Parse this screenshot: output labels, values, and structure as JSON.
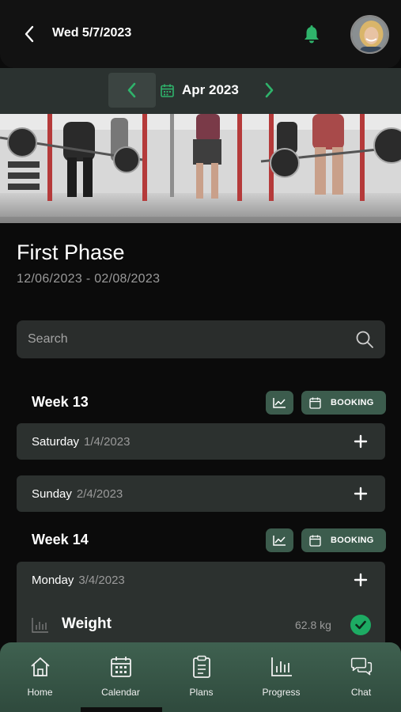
{
  "header": {
    "date": "Wed 5/7/2023"
  },
  "month_nav": {
    "label": "Apr 2023"
  },
  "phase": {
    "title": "First Phase",
    "dates": "12/06/2023 - 02/08/2023"
  },
  "search": {
    "placeholder": "Search"
  },
  "weeks": [
    {
      "title": "Week 13",
      "booking_label": "BOOKING",
      "days": [
        {
          "name": "Saturday",
          "date": "1/4/2023"
        },
        {
          "name": "Sunday",
          "date": "2/4/2023"
        }
      ]
    },
    {
      "title": "Week 14",
      "booking_label": "BOOKING",
      "days": [
        {
          "name": "Monday",
          "date": "3/4/2023",
          "entries": [
            {
              "name": "Weight",
              "value": "62.8 kg",
              "done": true
            }
          ]
        }
      ]
    }
  ],
  "nav": {
    "items": [
      {
        "label": "Home",
        "icon": "home-icon"
      },
      {
        "label": "Calendar",
        "icon": "calendar-icon",
        "active": true
      },
      {
        "label": "Plans",
        "icon": "clipboard-icon"
      },
      {
        "label": "Progress",
        "icon": "bar-chart-icon"
      },
      {
        "label": "Chat",
        "icon": "chat-icon"
      }
    ]
  },
  "colors": {
    "accent": "#2fb36b",
    "button": "#3c5c4d",
    "row": "#2c312f",
    "nav": "#3f6150"
  }
}
